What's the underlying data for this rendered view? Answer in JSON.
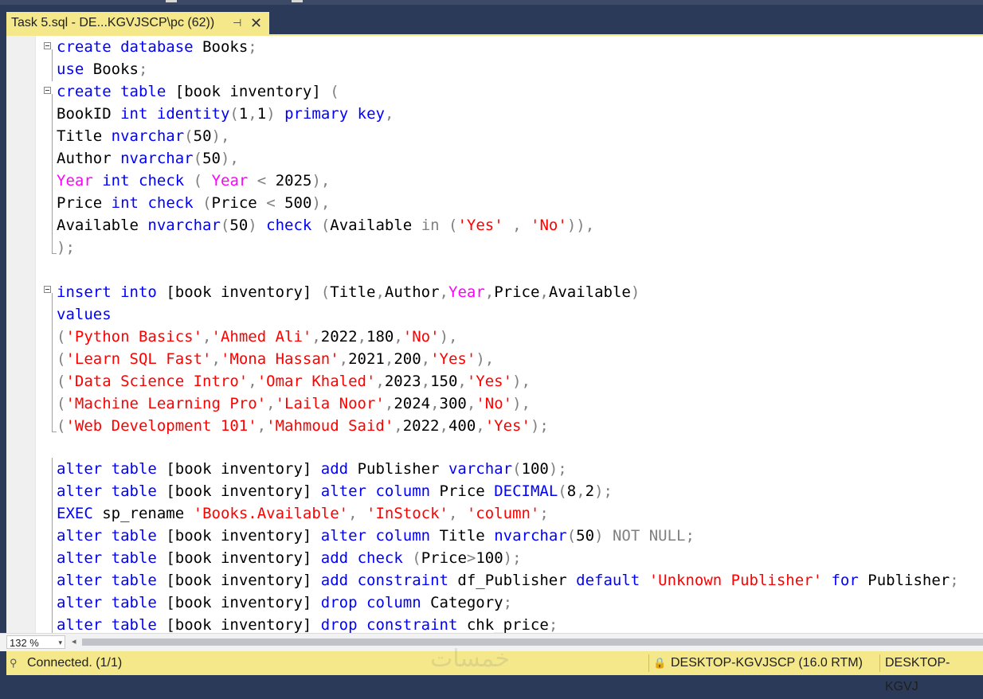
{
  "tab": {
    "title": "Task 5.sql - DE...KGVJSCP\\pc (62))",
    "pin_icon": "pin-icon",
    "close_icon": "close-icon",
    "pin_glyph": "⊣",
    "close_glyph": "✕"
  },
  "colors": {
    "keyword": "#0000ff",
    "string": "#ff0000",
    "builtin": "#ff00ff",
    "operator": "#808080",
    "tab_active": "#f5e88a"
  },
  "code": {
    "l1": [
      "create",
      "database",
      "Books"
    ],
    "l2": [
      "use",
      "Books"
    ],
    "l3": [
      "create",
      "table",
      "[book inventory]"
    ],
    "l4": [
      "BookID",
      "int",
      "identity",
      "1",
      "1",
      "primary",
      "key"
    ],
    "l5": [
      "Title",
      "nvarchar",
      "50"
    ],
    "l6": [
      "Author",
      "nvarchar",
      "50"
    ],
    "l7": [
      "Year",
      "int",
      "check",
      "Year",
      "2025"
    ],
    "l8": [
      "Price",
      "int",
      "check",
      "Price",
      "500"
    ],
    "l9": [
      "Available",
      "nvarchar",
      "50",
      "check",
      "Available",
      "in",
      "'Yes'",
      "'No'"
    ],
    "l10": [],
    "l12": [
      "insert",
      "into",
      "[book inventory]",
      "Title",
      "Author",
      "Year",
      "Price",
      "Available"
    ],
    "l13": [
      "values"
    ],
    "l14": [
      "'Python Basics'",
      "'Ahmed Ali'",
      "2022",
      "180",
      "'No'"
    ],
    "l15": [
      "'Learn SQL Fast'",
      "'Mona Hassan'",
      "2021",
      "200",
      "'Yes'"
    ],
    "l16": [
      "'Data Science Intro'",
      "'Omar Khaled'",
      "2023",
      "150",
      "'Yes'"
    ],
    "l17": [
      "'Machine Learning Pro'",
      "'Laila Noor'",
      "2024",
      "300",
      "'No'"
    ],
    "l18": [
      "'Web Development 101'",
      "'Mahmoud Said'",
      "2022",
      "400",
      "'Yes'"
    ],
    "l20": [
      "alter",
      "table",
      "[book inventory]",
      "add",
      "Publisher",
      "varchar",
      "100"
    ],
    "l21": [
      "alter",
      "table",
      "[book inventory]",
      "alter",
      "column",
      "Price",
      "DECIMAL",
      "8",
      "2"
    ],
    "l22": [
      "EXEC",
      "sp_rename",
      "'Books.Available'",
      "'InStock'",
      "'column'"
    ],
    "l23": [
      "alter",
      "table",
      "[book inventory]",
      "alter",
      "column",
      "Title",
      "nvarchar",
      "50",
      "NOT NULL"
    ],
    "l24": [
      "alter",
      "table",
      "[book inventory]",
      "add",
      "check",
      "Price",
      "100"
    ],
    "l25": [
      "alter",
      "table",
      "[book inventory]",
      "add",
      "constraint",
      "df_Publisher",
      "default",
      "'Unknown Publisher'",
      "for",
      "Publisher"
    ],
    "l26": [
      "alter",
      "table",
      "[book inventory]",
      "drop",
      "column",
      "Category"
    ],
    "l27": [
      "alter",
      "table",
      "[book inventory]",
      "drop",
      "constraint",
      "chk_price"
    ]
  },
  "zoom": {
    "value": "132 %",
    "dropdown_icon": "chevron-down-icon",
    "dropdown_glyph": "▾",
    "scroll_left_glyph": "◂"
  },
  "status": {
    "icon": "connected-icon",
    "icon_glyph": "⚲",
    "text": "Connected. (1/1)",
    "lock_icon": "lock-icon",
    "lock_glyph": "🔒",
    "server": "DESKTOP-KGVJSCP (16.0 RTM)",
    "server_user": "DESKTOP-KGVJ"
  },
  "watermark": "خمسات"
}
